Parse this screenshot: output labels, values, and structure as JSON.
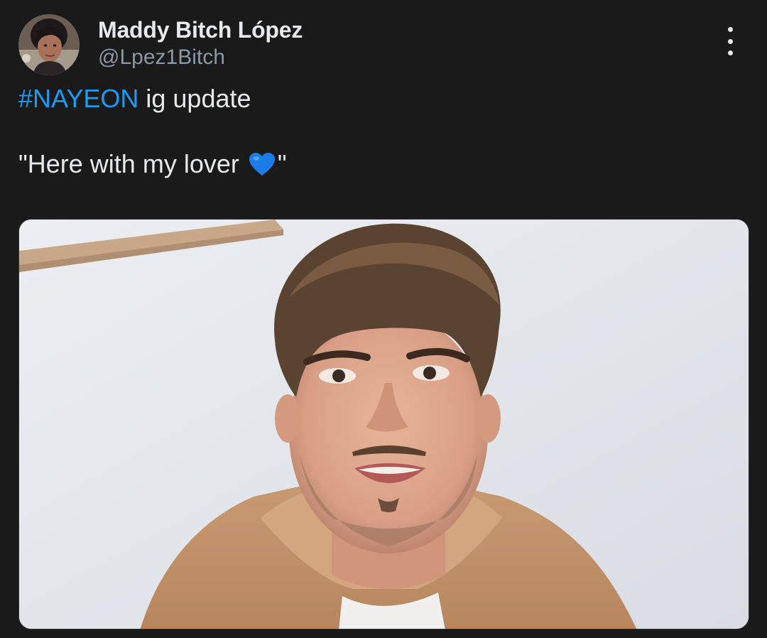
{
  "author": {
    "display_name": "Maddy Bitch López",
    "handle": "@Lpez1Bitch",
    "avatar_icon": "profile-photo"
  },
  "tweet": {
    "hashtag": "#NAYEON",
    "line1_rest": " ig update",
    "quote_open": "\"Here with my lover ",
    "quote_close": "\"",
    "emoji": "blue-heart-icon"
  },
  "menu": {
    "icon": "more-options-icon"
  },
  "media": {
    "description_icon": "attached-photo"
  },
  "colors": {
    "background": "#1a1a1b",
    "hashtag": "#1d9bf0",
    "handle": "#8b98a5",
    "text": "#e7e9ea",
    "heart": "#1d7de8"
  }
}
